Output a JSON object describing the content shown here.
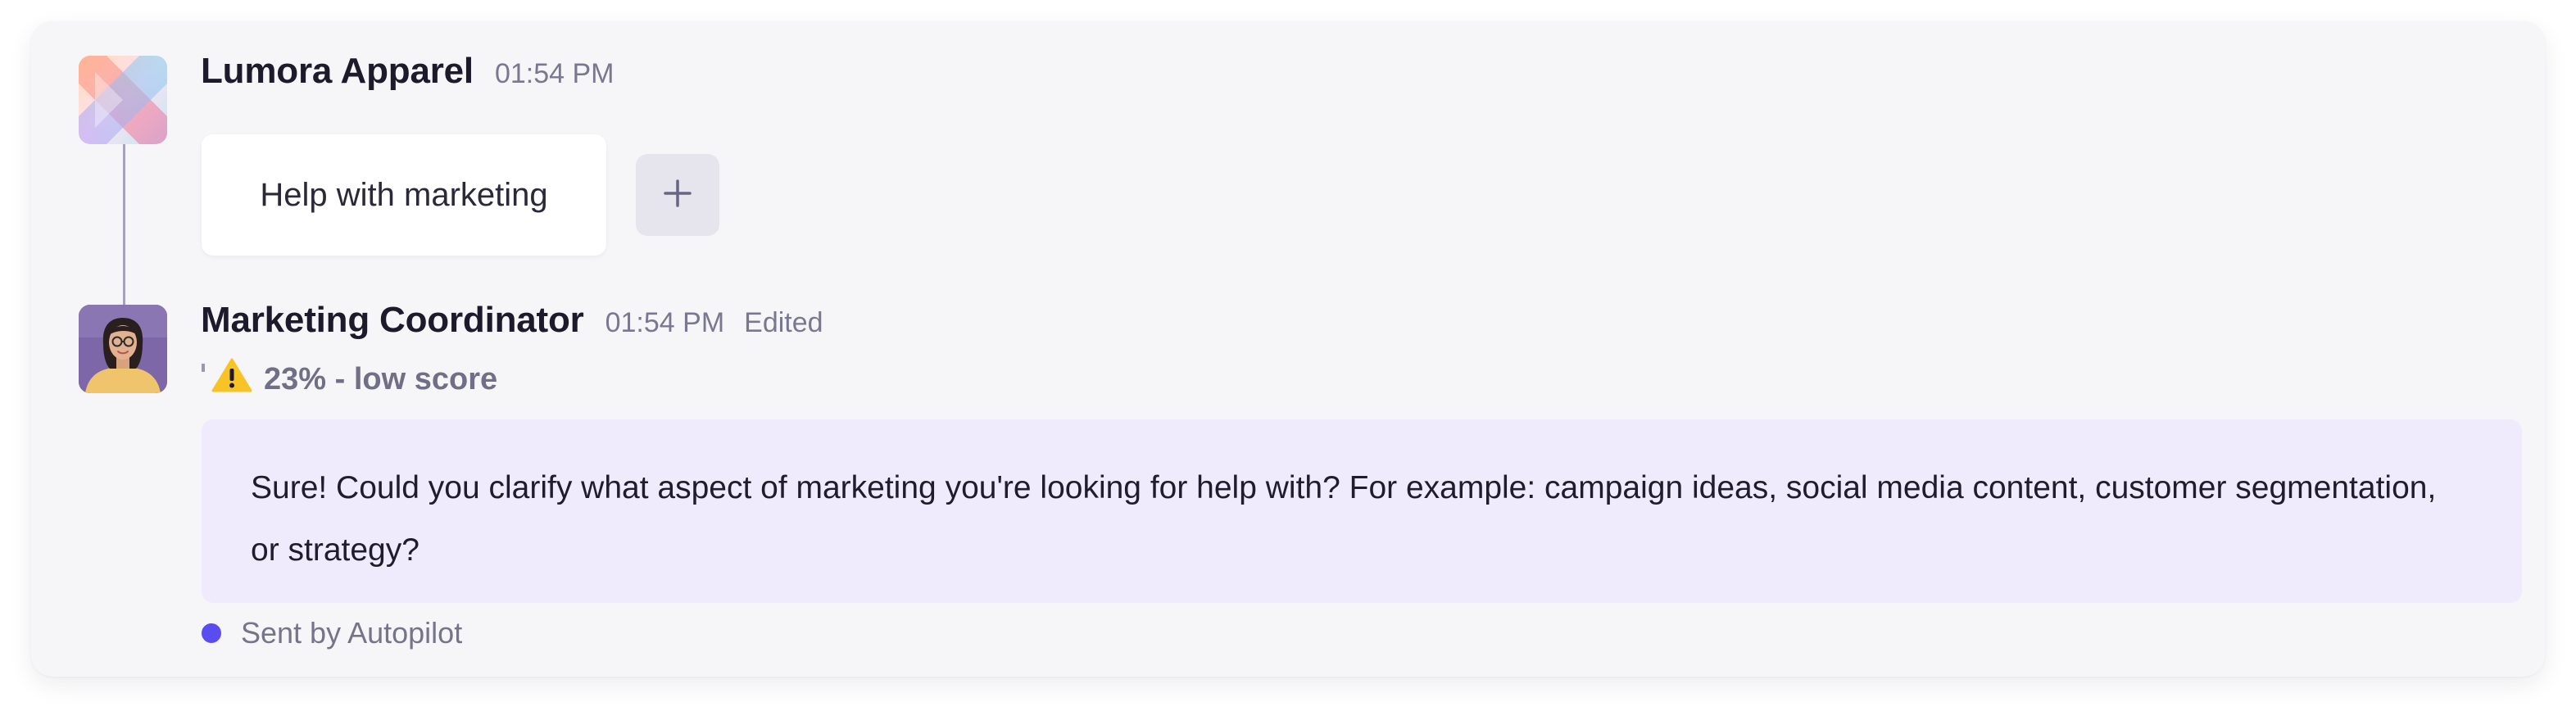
{
  "thread": {
    "first_message": {
      "sender": "Lumora Apparel",
      "time": "01:54 PM",
      "avatar_icon": "lumora-apparel-logo-icon",
      "quick_reply": "Help with marketing",
      "add_icon": "plus-icon"
    },
    "reply": {
      "sender": "Marketing Coordinator",
      "time": "01:54 PM",
      "edited_label": "Edited",
      "avatar_icon": "user-avatar",
      "score_icon": "warning-icon",
      "score_text": "23% - low score",
      "body": "Sure! Could you clarify what aspect of marketing you're looking for help with? For example: campaign ideas, social media content, customer segmentation, or strategy?",
      "footer": "Sent by Autopilot",
      "footer_dot_color": "#5b4cf2",
      "bubble_color": "#efeafc"
    }
  }
}
